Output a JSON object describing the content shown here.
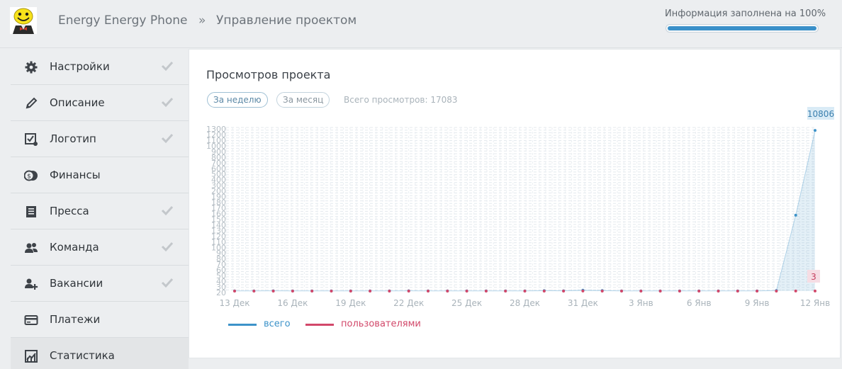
{
  "header": {
    "project_name": "Energy Energy Phone",
    "breadcrumb_separator": "»",
    "page_title": "Управление проектом",
    "fill_status": "Информация заполнена на 100%",
    "fill_progress_percent": 100
  },
  "sidebar": {
    "items": [
      {
        "label": "Настройки",
        "icon": "gear-icon",
        "checked": true
      },
      {
        "label": "Описание",
        "icon": "pencil-icon",
        "checked": true
      },
      {
        "label": "Логотип",
        "icon": "image-icon",
        "checked": true
      },
      {
        "label": "Финансы",
        "icon": "coins-icon",
        "checked": false
      },
      {
        "label": "Пресса",
        "icon": "document-icon",
        "checked": true
      },
      {
        "label": "Команда",
        "icon": "users-icon",
        "checked": true
      },
      {
        "label": "Вакансии",
        "icon": "add-user-icon",
        "checked": true
      },
      {
        "label": "Платежи",
        "icon": "card-icon",
        "checked": false
      },
      {
        "label": "Статистика",
        "icon": "chart-icon",
        "checked": false,
        "active": true
      }
    ]
  },
  "main": {
    "title": "Просмотров проекта",
    "tabs": [
      {
        "label": "За неделю",
        "active": true
      },
      {
        "label": "За месяц",
        "active": false
      }
    ],
    "total_views": "Всего просмотров: 17083"
  },
  "colors": {
    "accent": "#3a90c9",
    "series_total": "#3d93c9",
    "series_users": "#d2486a"
  },
  "chart_data": {
    "type": "area",
    "x_tick_labels": [
      "13 Дек",
      "16 Дек",
      "19 Дек",
      "22 Дек",
      "25 Дек",
      "28 Дек",
      "31 Дек",
      "3 Янв",
      "6 Янв",
      "9 Янв",
      "12 Янв"
    ],
    "x": [
      "13 Дек",
      "14 Дек",
      "15 Дек",
      "16 Дек",
      "17 Дек",
      "18 Дек",
      "19 Дек",
      "20 Дек",
      "21 Дек",
      "22 Дек",
      "23 Дек",
      "24 Дек",
      "25 Дек",
      "26 Дек",
      "27 Дек",
      "28 Дек",
      "29 Дек",
      "30 Дек",
      "31 Дек",
      "1 Янв",
      "2 Янв",
      "3 Янв",
      "4 Янв",
      "5 Янв",
      "6 Янв",
      "7 Янв",
      "8 Янв",
      "9 Янв",
      "10 Янв",
      "11 Янв",
      "12 Янв"
    ],
    "series": [
      {
        "name": "всего",
        "values": [
          10,
          8,
          20,
          10,
          15,
          8,
          12,
          10,
          14,
          20,
          12,
          10,
          15,
          12,
          10,
          12,
          30,
          20,
          60,
          40,
          15,
          15,
          12,
          10,
          14,
          10,
          12,
          10,
          40,
          5100,
          10806
        ]
      },
      {
        "name": "пользователями",
        "values": [
          1,
          1,
          2,
          1,
          2,
          1,
          1,
          1,
          2,
          2,
          1,
          1,
          2,
          1,
          1,
          1,
          2,
          2,
          3,
          2,
          1,
          1,
          1,
          1,
          2,
          1,
          1,
          1,
          2,
          3,
          3
        ]
      }
    ],
    "last_value_labels": [
      "10806",
      "3"
    ],
    "ylim": [
      0,
      11000
    ],
    "y_tick_labels": [
      "1300",
      "1200",
      "1100",
      "1000",
      "900",
      "800",
      "700",
      "600",
      "500",
      "400",
      "300",
      "200",
      "190",
      "180",
      "170",
      "160",
      "150",
      "140",
      "130",
      "120",
      "110",
      "100",
      "90",
      "80",
      "70",
      "60",
      "50",
      "40",
      "30",
      "20"
    ],
    "grid": true,
    "legend_position": "bottom-left"
  }
}
